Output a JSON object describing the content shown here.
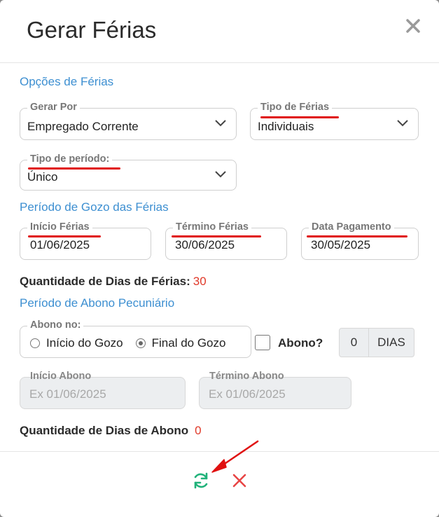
{
  "header": {
    "title": "Gerar Férias"
  },
  "sections": {
    "opcoes": "Opções de Férias",
    "gozo": "Período de Gozo das Férias",
    "abono": "Período de Abono Pecuniário"
  },
  "fields": {
    "gerar_por": {
      "label": "Gerar Por",
      "value": "Empregado Corrente"
    },
    "tipo_ferias": {
      "label": "Tipo de Férias",
      "value": "Individuais"
    },
    "tipo_periodo": {
      "label": "Tipo de período:",
      "value": "Único"
    },
    "inicio_ferias": {
      "label": "Início Férias",
      "value": "01/06/2025"
    },
    "termino_ferias": {
      "label": "Término Férias",
      "value": "30/06/2025"
    },
    "data_pagamento": {
      "label": "Data Pagamento",
      "value": "30/05/2025"
    },
    "abono_no": {
      "label": "Abono no:",
      "options": [
        "Início do Gozo",
        "Final do Gozo"
      ],
      "selected": "Final do Gozo"
    },
    "abono_checkbox": {
      "label": "Abono?",
      "checked": false
    },
    "dias": {
      "value": "0",
      "unit": "DIAS"
    },
    "inicio_abono": {
      "label": "Início Abono",
      "placeholder": "Ex 01/06/2025"
    },
    "termino_abono": {
      "label": "Término Abono",
      "placeholder": "Ex 01/06/2025"
    }
  },
  "quantities": {
    "dias_ferias_label": "Quantidade de Dias de Férias:",
    "dias_ferias_value": "30",
    "dias_abono_label": "Quantidade de Dias de Abono",
    "dias_abono_value": "0"
  },
  "footer": {
    "icons": [
      "refresh-icon",
      "close-icon"
    ]
  },
  "colors": {
    "section": "#3d8fd1",
    "highlight": "#e01010",
    "refresh": "#20b27a",
    "cancel": "#e84545"
  }
}
